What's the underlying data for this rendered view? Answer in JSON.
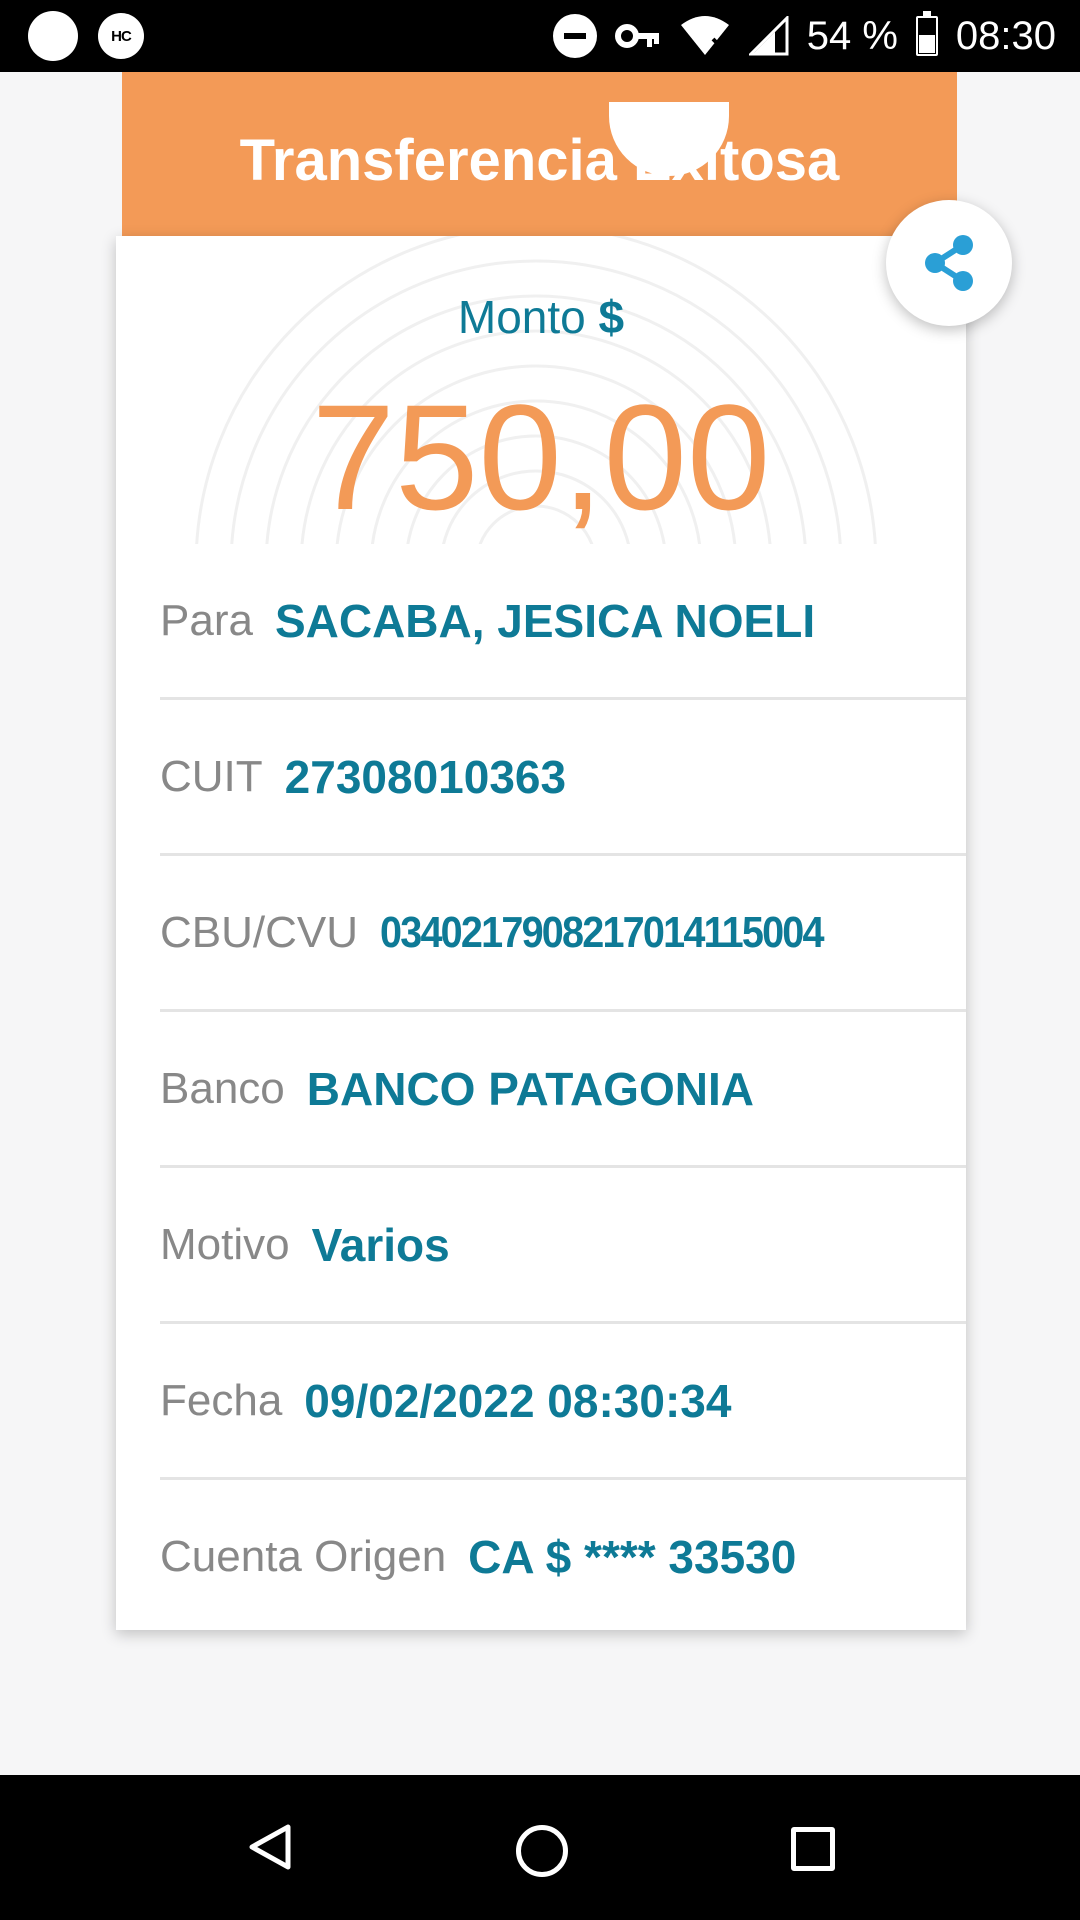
{
  "status_bar": {
    "left_badge": "HC",
    "battery": "54 %",
    "time": "08:30",
    "icons": [
      "dnd-icon",
      "vpn-key-icon",
      "wifi-icon",
      "signal-icon",
      "battery-icon"
    ]
  },
  "header": {
    "title": "Transferencia Exitosa"
  },
  "amount": {
    "label": "Monto",
    "currency": "$",
    "value": "750,00"
  },
  "details": [
    {
      "label": "Para",
      "value": "SACABA, JESICA NOELI"
    },
    {
      "label": "CUIT",
      "value": "27308010363"
    },
    {
      "label": "CBU/CVU",
      "value": "0340217908217014115004"
    },
    {
      "label": "Banco",
      "value": "BANCO PATAGONIA"
    },
    {
      "label": "Motivo",
      "value": "Varios"
    },
    {
      "label": "Fecha",
      "value": "09/02/2022 08:30:34"
    },
    {
      "label": "Cuenta Origen",
      "value": "CA $ **** 33530"
    }
  ],
  "colors": {
    "accent": "#f39a57",
    "text_primary": "#0e7a96",
    "share_icon": "#2a9fd6"
  },
  "nav": {
    "icons": [
      "back-icon",
      "home-icon",
      "recents-icon"
    ]
  }
}
